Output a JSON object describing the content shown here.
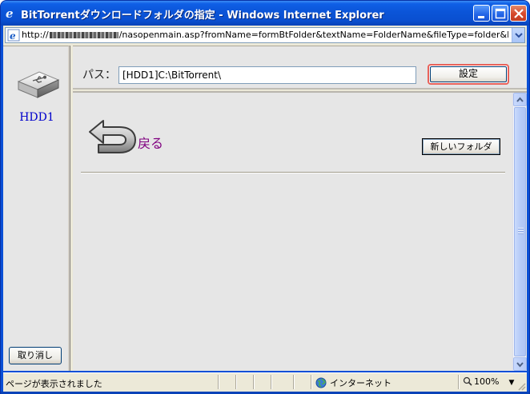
{
  "window": {
    "title": "BitTorrentダウンロードフォルダの指定 - Windows Internet Explorer"
  },
  "address": {
    "url_prefix": "http://",
    "url_suffix": "/nasopenmain.asp?fromName=formBtFolder&textName=FolderName&fileType=folder&Planex_Windc"
  },
  "left_pane": {
    "drive_label": "HDD1",
    "cancel_label": "取り消し"
  },
  "path_bar": {
    "label": "パス：",
    "value": "[HDD1]C:\\BitTorrent\\",
    "set_label": "設定"
  },
  "main": {
    "back_label": "戻る",
    "new_folder_label": "新しいフォルダ"
  },
  "status": {
    "text": "ページが表示されました",
    "zone": "インターネット",
    "zoom": "100%"
  },
  "colors": {
    "titlebar": "#0a4fd6",
    "link_visited": "#800080",
    "drive_label": "#0000cc",
    "highlight_border": "#e8625a"
  }
}
